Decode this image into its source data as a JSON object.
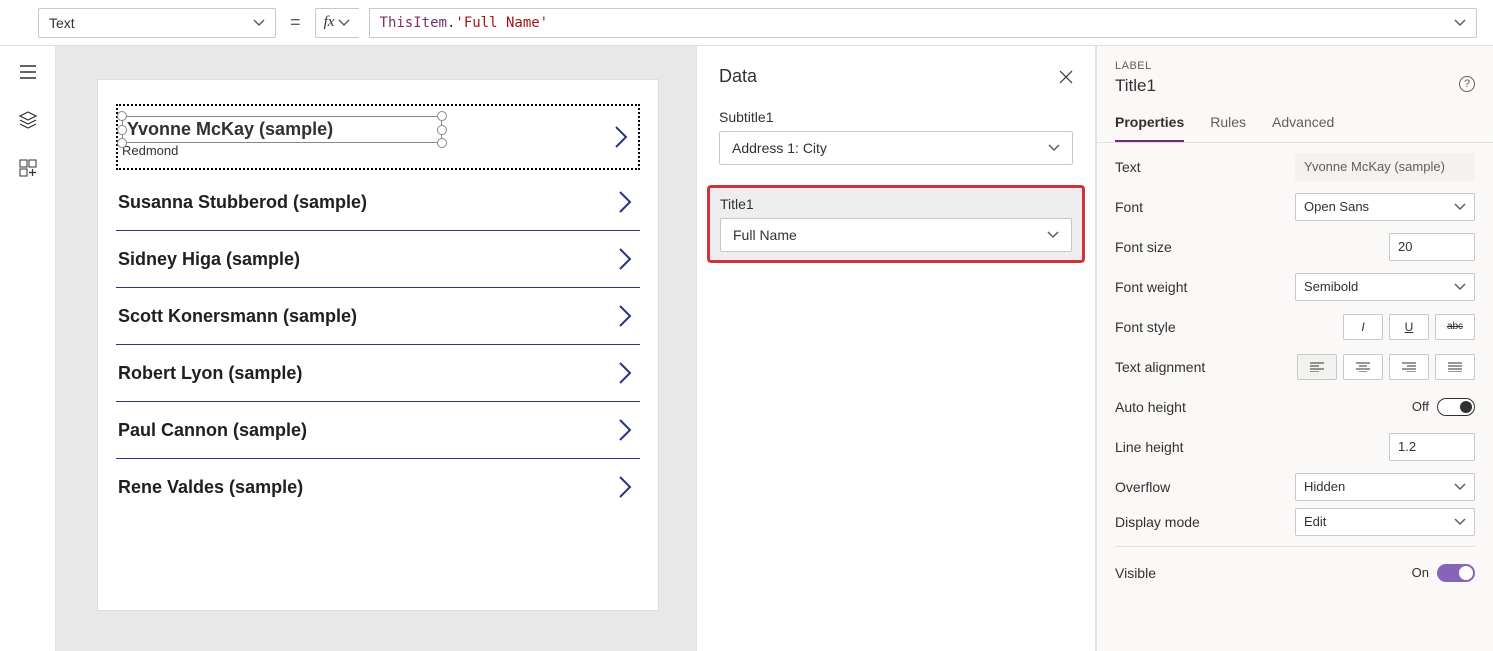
{
  "formulaBar": {
    "property": "Text",
    "formula_obj": "ThisItem",
    "formula_dot": ".",
    "formula_prop": "'Full Name'"
  },
  "gallery": {
    "selected": {
      "title": "Yvonne McKay (sample)",
      "subtitle": "Redmond"
    },
    "items": [
      {
        "title": "Susanna Stubberod (sample)"
      },
      {
        "title": "Sidney Higa (sample)"
      },
      {
        "title": "Scott Konersmann (sample)"
      },
      {
        "title": "Robert Lyon (sample)"
      },
      {
        "title": "Paul Cannon (sample)"
      },
      {
        "title": "Rene Valdes (sample)"
      }
    ]
  },
  "dataPanel": {
    "title": "Data",
    "subtitle_label": "Subtitle1",
    "subtitle_value": "Address 1: City",
    "title_label": "Title1",
    "title_value": "Full Name"
  },
  "props": {
    "type": "LABEL",
    "name": "Title1",
    "tabs": {
      "properties": "Properties",
      "rules": "Rules",
      "advanced": "Advanced"
    },
    "rows": {
      "text_label": "Text",
      "text_value": "Yvonne McKay (sample)",
      "font_label": "Font",
      "font_value": "Open Sans",
      "fontsize_label": "Font size",
      "fontsize_value": "20",
      "fontweight_label": "Font weight",
      "fontweight_value": "Semibold",
      "fontstyle_label": "Font style",
      "align_label": "Text alignment",
      "autoheight_label": "Auto height",
      "autoheight_state": "Off",
      "lineheight_label": "Line height",
      "lineheight_value": "1.2",
      "overflow_label": "Overflow",
      "overflow_value": "Hidden",
      "display_label": "Display mode",
      "display_value": "Edit",
      "visible_label": "Visible",
      "visible_state": "On"
    }
  }
}
